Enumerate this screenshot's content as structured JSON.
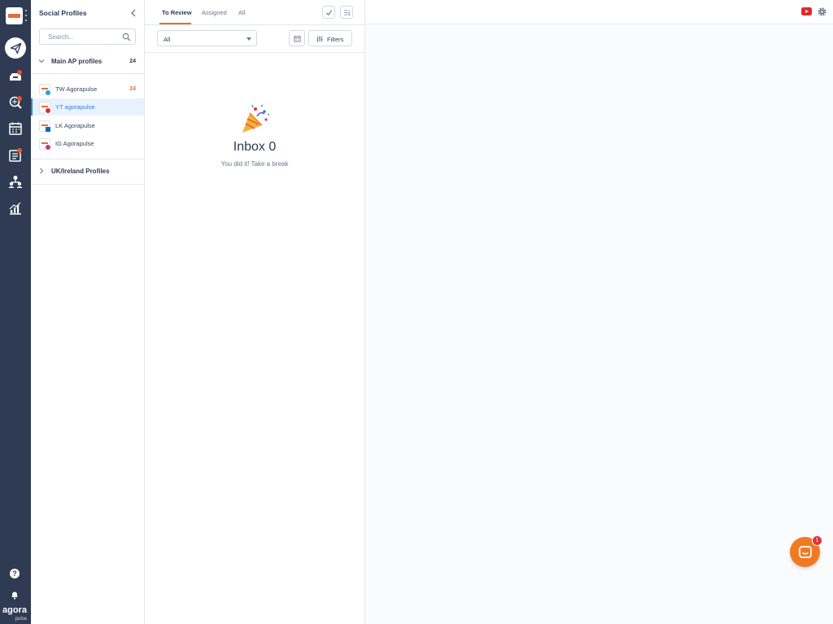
{
  "profiles_panel": {
    "title": "Social Profiles",
    "search_placeholder": "Search...",
    "groups": [
      {
        "name": "Main AP profiles",
        "count": "24",
        "expanded": true
      },
      {
        "name": "UK/Ireland Profiles",
        "count": "",
        "expanded": false
      }
    ],
    "profiles": [
      {
        "name": "TW Agorapulse",
        "network": "twitter",
        "badge_color": "#1da1f2",
        "count": "24"
      },
      {
        "name": "YT agorapulse",
        "network": "youtube",
        "badge_color": "#e0282d",
        "count": "",
        "selected": true
      },
      {
        "name": "LK Agorapulse",
        "network": "linkedin",
        "badge_color": "#0a66c2",
        "count": ""
      },
      {
        "name": "IG Agorapulse",
        "network": "instagram",
        "badge_color": "#d6307c",
        "count": ""
      }
    ]
  },
  "inbox": {
    "tabs": [
      "To Review",
      "Assigned",
      "All"
    ],
    "active_tab": "To Review",
    "filter_select": "All",
    "filters_label": "Filters",
    "empty_title": "Inbox 0",
    "empty_subtitle": "You did it! Take a break",
    "empty_icon": "party-popper-icon"
  },
  "rail": {
    "brand_main": "agora",
    "brand_sub": "pulse",
    "help_glyph": "?"
  },
  "chat": {
    "badge": "1"
  },
  "colors": {
    "rail": "#2e3b52",
    "accent": "#e86b3a",
    "selected": "#2f80e0",
    "chat": "#f07a22"
  }
}
